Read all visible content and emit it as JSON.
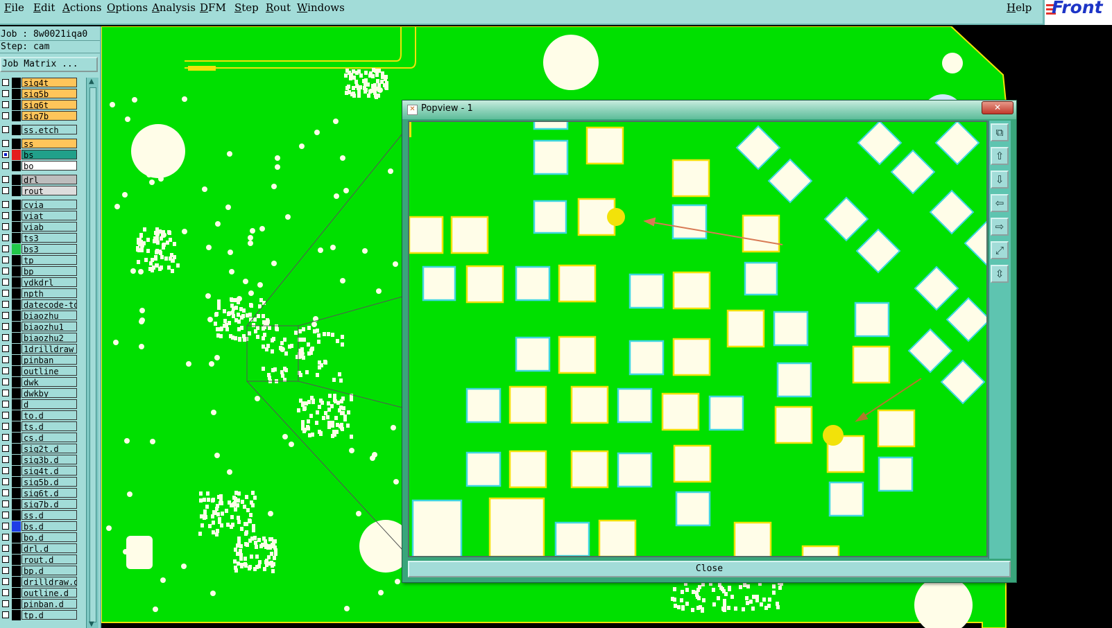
{
  "menubar": {
    "items": [
      "File",
      "Edit",
      "Actions",
      "Options",
      "Analysis",
      "DFM",
      "Step",
      "Rout",
      "Windows"
    ],
    "help": "Help",
    "logo": "Front"
  },
  "job": {
    "job_line": "Job : 8w0021iqa0",
    "step_line": "Step: cam",
    "job_matrix_button": "Job Matrix ..."
  },
  "layers": [
    {
      "name": "sig4t",
      "color": "#ffc55a",
      "swatch": "#000",
      "checked": false
    },
    {
      "name": "sig5b",
      "color": "#ffc55a",
      "swatch": "#000",
      "checked": false
    },
    {
      "name": "sig6t",
      "color": "#ffc55a",
      "swatch": "#000",
      "checked": false
    },
    {
      "name": "sig7b",
      "color": "#ffc55a",
      "swatch": "#000",
      "checked": false
    },
    {
      "name": "ss.etch",
      "color": "#a2dcd8",
      "swatch": "#000",
      "checked": false
    },
    {
      "name": "ss",
      "color": "#ffc55a",
      "swatch": "#000",
      "checked": false
    },
    {
      "name": "bs",
      "color": "#21a08a",
      "swatch": "#e41e1e",
      "checked": true
    },
    {
      "name": "bo",
      "color": "#ffffff",
      "swatch": "#000",
      "checked": false
    },
    {
      "name": "drl",
      "color": "#bdbdbd",
      "swatch": "#000",
      "checked": false
    },
    {
      "name": "rout",
      "color": "#dddddd",
      "swatch": "#000",
      "checked": false
    },
    {
      "name": "cvia",
      "color": "#a2dcd8",
      "swatch": "#000",
      "checked": false
    },
    {
      "name": "viat",
      "color": "#a2dcd8",
      "swatch": "#000",
      "checked": false
    },
    {
      "name": "viab",
      "color": "#a2dcd8",
      "swatch": "#000",
      "checked": false
    },
    {
      "name": "ts3",
      "color": "#a2dcd8",
      "swatch": "#000",
      "checked": false
    },
    {
      "name": "bs3",
      "color": "#a2dcd8",
      "swatch": "#22c84a",
      "checked": false
    },
    {
      "name": "tp",
      "color": "#a2dcd8",
      "swatch": "#000",
      "checked": false
    },
    {
      "name": "bp",
      "color": "#a2dcd8",
      "swatch": "#000",
      "checked": false
    },
    {
      "name": "ydkdrl",
      "color": "#a2dcd8",
      "swatch": "#000",
      "checked": false
    },
    {
      "name": "npth",
      "color": "#a2dcd8",
      "swatch": "#000",
      "checked": false
    },
    {
      "name": "datecode-to",
      "color": "#a2dcd8",
      "swatch": "#000",
      "checked": false
    },
    {
      "name": "biaozhu",
      "color": "#a2dcd8",
      "swatch": "#000",
      "checked": false
    },
    {
      "name": "biaozhu1",
      "color": "#a2dcd8",
      "swatch": "#000",
      "checked": false
    },
    {
      "name": "biaozhu2",
      "color": "#a2dcd8",
      "swatch": "#000",
      "checked": false
    },
    {
      "name": "1drilldraw",
      "color": "#a2dcd8",
      "swatch": "#000",
      "checked": false
    },
    {
      "name": "pinban",
      "color": "#a2dcd8",
      "swatch": "#000",
      "checked": false
    },
    {
      "name": "outline",
      "color": "#a2dcd8",
      "swatch": "#000",
      "checked": false
    },
    {
      "name": "dwk",
      "color": "#a2dcd8",
      "swatch": "#000",
      "checked": false
    },
    {
      "name": "dwkby",
      "color": "#a2dcd8",
      "swatch": "#000",
      "checked": false
    },
    {
      "name": "d",
      "color": "#a2dcd8",
      "swatch": "#000",
      "checked": false
    },
    {
      "name": "to.d",
      "color": "#a2dcd8",
      "swatch": "#000",
      "checked": false
    },
    {
      "name": "ts.d",
      "color": "#a2dcd8",
      "swatch": "#000",
      "checked": false
    },
    {
      "name": "cs.d",
      "color": "#a2dcd8",
      "swatch": "#000",
      "checked": false
    },
    {
      "name": "sig2t.d",
      "color": "#a2dcd8",
      "swatch": "#000",
      "checked": false
    },
    {
      "name": "sig3b.d",
      "color": "#a2dcd8",
      "swatch": "#000",
      "checked": false
    },
    {
      "name": "sig4t.d",
      "color": "#a2dcd8",
      "swatch": "#000",
      "checked": false
    },
    {
      "name": "sig5b.d",
      "color": "#a2dcd8",
      "swatch": "#000",
      "checked": false
    },
    {
      "name": "sig6t.d",
      "color": "#a2dcd8",
      "swatch": "#000",
      "checked": false
    },
    {
      "name": "sig7b.d",
      "color": "#a2dcd8",
      "swatch": "#000",
      "checked": false
    },
    {
      "name": "ss.d",
      "color": "#a2dcd8",
      "swatch": "#000",
      "checked": false
    },
    {
      "name": "bs.d",
      "color": "#a2dcd8",
      "swatch": "#1f3ee6",
      "checked": false
    },
    {
      "name": "bo.d",
      "color": "#a2dcd8",
      "swatch": "#000",
      "checked": false
    },
    {
      "name": "drl.d",
      "color": "#a2dcd8",
      "swatch": "#000",
      "checked": false
    },
    {
      "name": "rout.d",
      "color": "#a2dcd8",
      "swatch": "#000",
      "checked": false
    },
    {
      "name": "bp.d",
      "color": "#a2dcd8",
      "swatch": "#000",
      "checked": false
    },
    {
      "name": "drilldraw.d",
      "color": "#a2dcd8",
      "swatch": "#000",
      "checked": false
    },
    {
      "name": "outline.d",
      "color": "#a2dcd8",
      "swatch": "#000",
      "checked": false
    },
    {
      "name": "pinban.d",
      "color": "#a2dcd8",
      "swatch": "#000",
      "checked": false
    },
    {
      "name": "tp.d",
      "color": "#a2dcd8",
      "swatch": "#000",
      "checked": false
    }
  ],
  "popview": {
    "title": "Popview - 1",
    "close_button": "Close",
    "tools": [
      "zoom-window-icon",
      "pan-up-icon",
      "pan-down-icon",
      "pan-left-icon",
      "pan-right-icon",
      "zoom-fit-icon",
      "zoom-home-icon"
    ]
  },
  "colors": {
    "board": "#00e000",
    "pad_fill": "#fffde8",
    "pad_edge_yellow": "#f2e20a",
    "pad_edge_cyan": "#3fd6e0",
    "trace": "#f2e20a",
    "ui_bg": "#a2dcd8"
  }
}
